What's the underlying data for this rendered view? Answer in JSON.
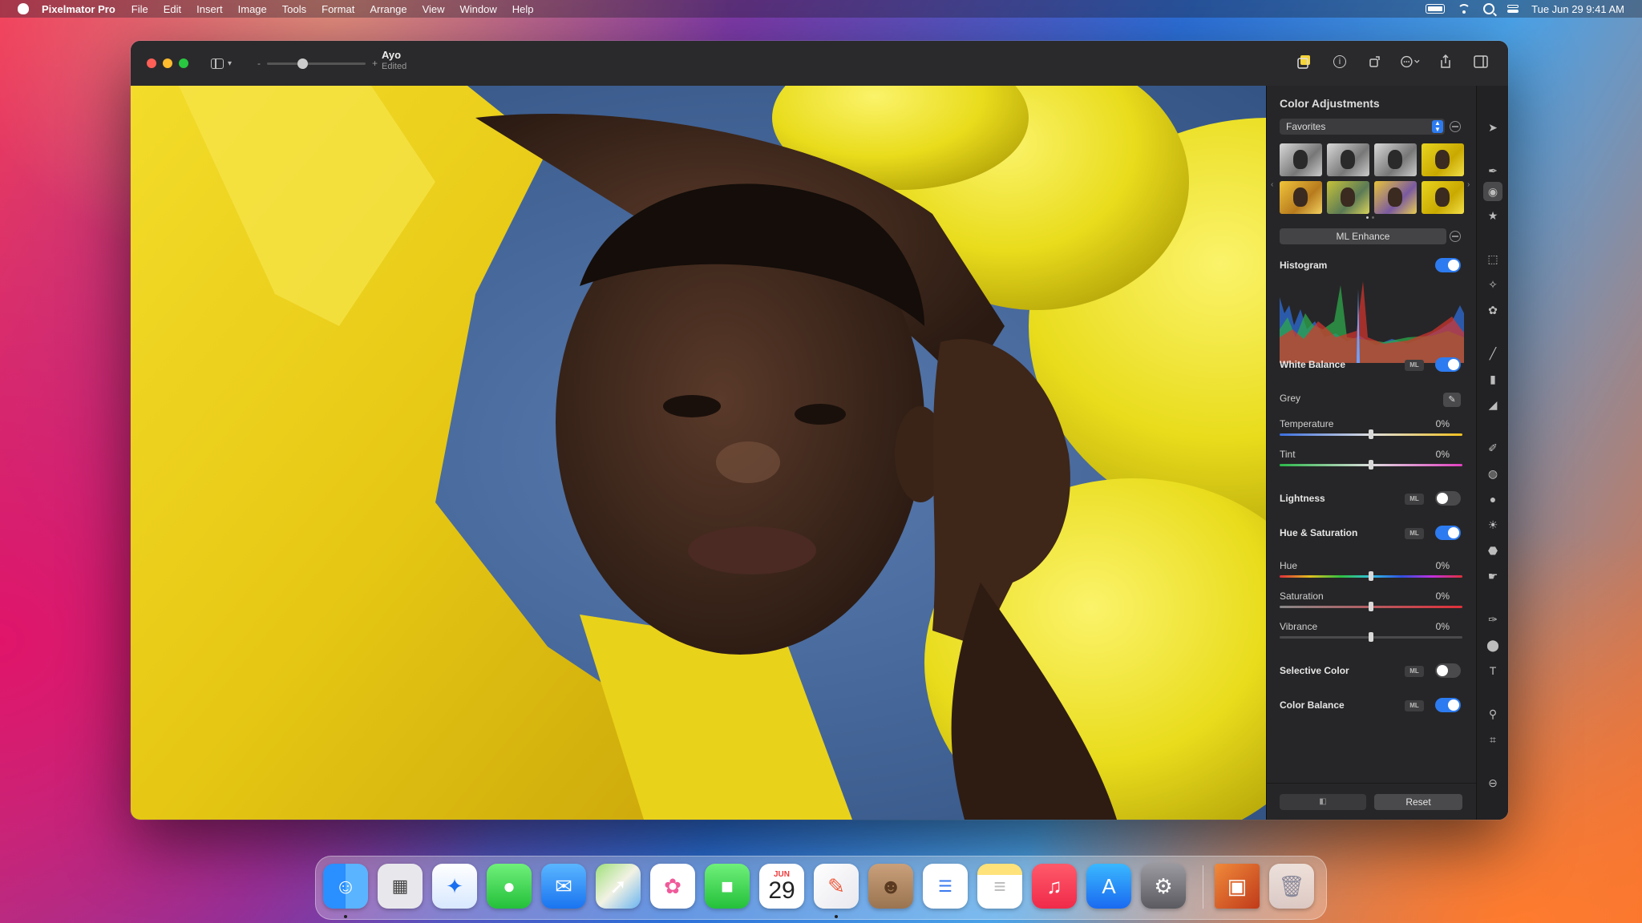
{
  "menubar": {
    "app_name": "Pixelmator Pro",
    "items": [
      "File",
      "Edit",
      "Insert",
      "Image",
      "Tools",
      "Format",
      "Arrange",
      "View",
      "Window",
      "Help"
    ],
    "clock": "Tue Jun 29  9:41 AM"
  },
  "window": {
    "doc_name": "Ayo",
    "doc_status": "Edited",
    "zoom_minus": "-",
    "zoom_plus": "+"
  },
  "panel": {
    "title": "Color Adjustments",
    "preset_select": "Favorites",
    "ml_enhance": "ML Enhance",
    "ml_chip": "ML",
    "sections": {
      "histogram": {
        "label": "Histogram",
        "enabled": true
      },
      "white_balance": {
        "label": "White Balance",
        "enabled": true,
        "grey_label": "Grey",
        "temperature": {
          "label": "Temperature",
          "value": "0%"
        },
        "tint": {
          "label": "Tint",
          "value": "0%"
        }
      },
      "lightness": {
        "label": "Lightness",
        "enabled": false
      },
      "hue_saturation": {
        "label": "Hue & Saturation",
        "enabled": true,
        "hue": {
          "label": "Hue",
          "value": "0%"
        },
        "saturation": {
          "label": "Saturation",
          "value": "0%"
        },
        "vibrance": {
          "label": "Vibrance",
          "value": "0%"
        }
      },
      "selective_color": {
        "label": "Selective Color",
        "enabled": false
      },
      "color_balance": {
        "label": "Color Balance",
        "enabled": true
      }
    },
    "reset": "Reset"
  },
  "dock": {
    "calendar_month": "JUN",
    "calendar_day": "29",
    "apps": [
      "finder-icon",
      "launchpad-icon",
      "safari-icon",
      "messages-icon",
      "mail-icon",
      "maps-icon",
      "photos-icon",
      "facetime-icon",
      "calendar-icon",
      "pixelmator-icon",
      "contacts-icon",
      "reminders-icon",
      "notes-icon",
      "music-icon",
      "app-store-icon",
      "system-preferences-icon",
      "document-thumbnail-icon",
      "trash-icon"
    ]
  },
  "colors": {
    "accent": "#2d7bf0",
    "yellow": "#f1e42a",
    "sky": "#3c5d8d"
  }
}
